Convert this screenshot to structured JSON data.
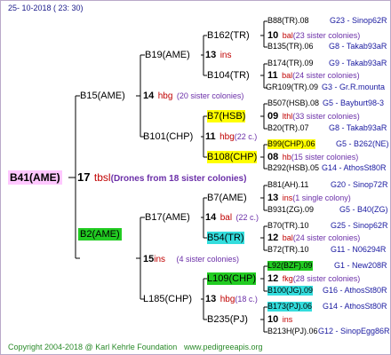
{
  "header": {
    "date": "25- 10-2018 ( 23: 30)"
  },
  "root": {
    "name": "B41(AME)",
    "gen_number": "17",
    "breeder": "tbsl",
    "note": "(Drones from 18 sister colonies)"
  },
  "gen1": [
    {
      "name": "B15(AME)",
      "gen_number": "14",
      "breeder": "hbg",
      "note": "(20 sister colonies)"
    },
    {
      "name": "B2(AME)",
      "gen_number": "15",
      "breeder": "ins",
      "note": "(4 sister colonies)"
    }
  ],
  "gen2": [
    {
      "name": "B19(AME)",
      "gen_number": "13",
      "breeder": "ins",
      "note": ""
    },
    {
      "name": "B101(CHP)",
      "gen_number": "11",
      "breeder": "hbg",
      "note": "(22 c.)"
    },
    {
      "name": "B17(AME)",
      "gen_number": "14",
      "breeder": "bal",
      "note": "(22 c.)"
    },
    {
      "name": "L185(CHP)",
      "gen_number": "13",
      "breeder": "hbg",
      "note": "(18 c.)"
    }
  ],
  "gen3": [
    {
      "name": "B162(TR)",
      "gen_number": "10",
      "breeder": "bal",
      "note": "(23 sister colonies)"
    },
    {
      "name": "B104(TR)",
      "gen_number": "11",
      "breeder": "bal",
      "note": "(24 sister colonies)"
    },
    {
      "name": "B7(HSB)",
      "gen_number": "09",
      "breeder": "lthl",
      "note": "(33 sister colonies)"
    },
    {
      "name": "B108(CHP)",
      "gen_number": "08",
      "breeder": "hb",
      "note": "(15 sister colonies)"
    },
    {
      "name": "B7(AME)",
      "gen_number": "13",
      "breeder": "ins",
      "note": "(1 single colony)"
    },
    {
      "name": "B54(TR)",
      "gen_number": "12",
      "breeder": "bal",
      "note": "(24 sister colonies)"
    },
    {
      "name": "L109(CHP)",
      "gen_number": "12",
      "breeder": "fkg",
      "note": "(28 sister colonies)"
    },
    {
      "name": "B235(PJ)",
      "gen_number": "10",
      "breeder": "ins",
      "note": ""
    }
  ],
  "gen4": [
    {
      "name": "B88(TR).08",
      "origin": "G23 - Sinop62R"
    },
    {
      "name": "B135(TR).06",
      "origin": "G8 - Takab93aR"
    },
    {
      "name": "B174(TR).09",
      "origin": "G9 - Takab93aR"
    },
    {
      "name": "GR109(TR).09",
      "origin": "G3 - Gr.R.mounta"
    },
    {
      "name": "B507(HSB).08",
      "origin": "G5 - Bayburt98-3"
    },
    {
      "name": "B20(TR).07",
      "origin": "G8 - Takab93aR"
    },
    {
      "name": "B99(CHP).06",
      "origin": "G5 - B262(NE)"
    },
    {
      "name": "B292(HSB).05",
      "origin": "G14 - AthosSt80R"
    },
    {
      "name": "B81(AH).11",
      "origin": "G20 - Sinop72R"
    },
    {
      "name": "B931(ZG).09",
      "origin": "G5 - B40(ZG)"
    },
    {
      "name": "B70(TR).10",
      "origin": "G25 - Sinop62R"
    },
    {
      "name": "B72(TR).10",
      "origin": "G11 - N06294R"
    },
    {
      "name": "L92(BZF).09",
      "origin": "G1 - New208R"
    },
    {
      "name": "B100(JG).09",
      "origin": "G16 - AthosSt80R"
    },
    {
      "name": "B173(PJ).06",
      "origin": "G14 - AthosSt80R"
    },
    {
      "name": "B213H(PJ).06",
      "origin": "G12 - SinopEgg86R"
    }
  ],
  "footer": {
    "copyright": "Copyright 2004-2018 @ Karl Kehrle Foundation",
    "url": "www.pedigreeapis.org"
  },
  "colors": {
    "root_highlight": "#ffc8ff",
    "yellow": "#ffff00",
    "green": "#22cc22",
    "cyan": "#33dddd",
    "line": "#000000"
  }
}
